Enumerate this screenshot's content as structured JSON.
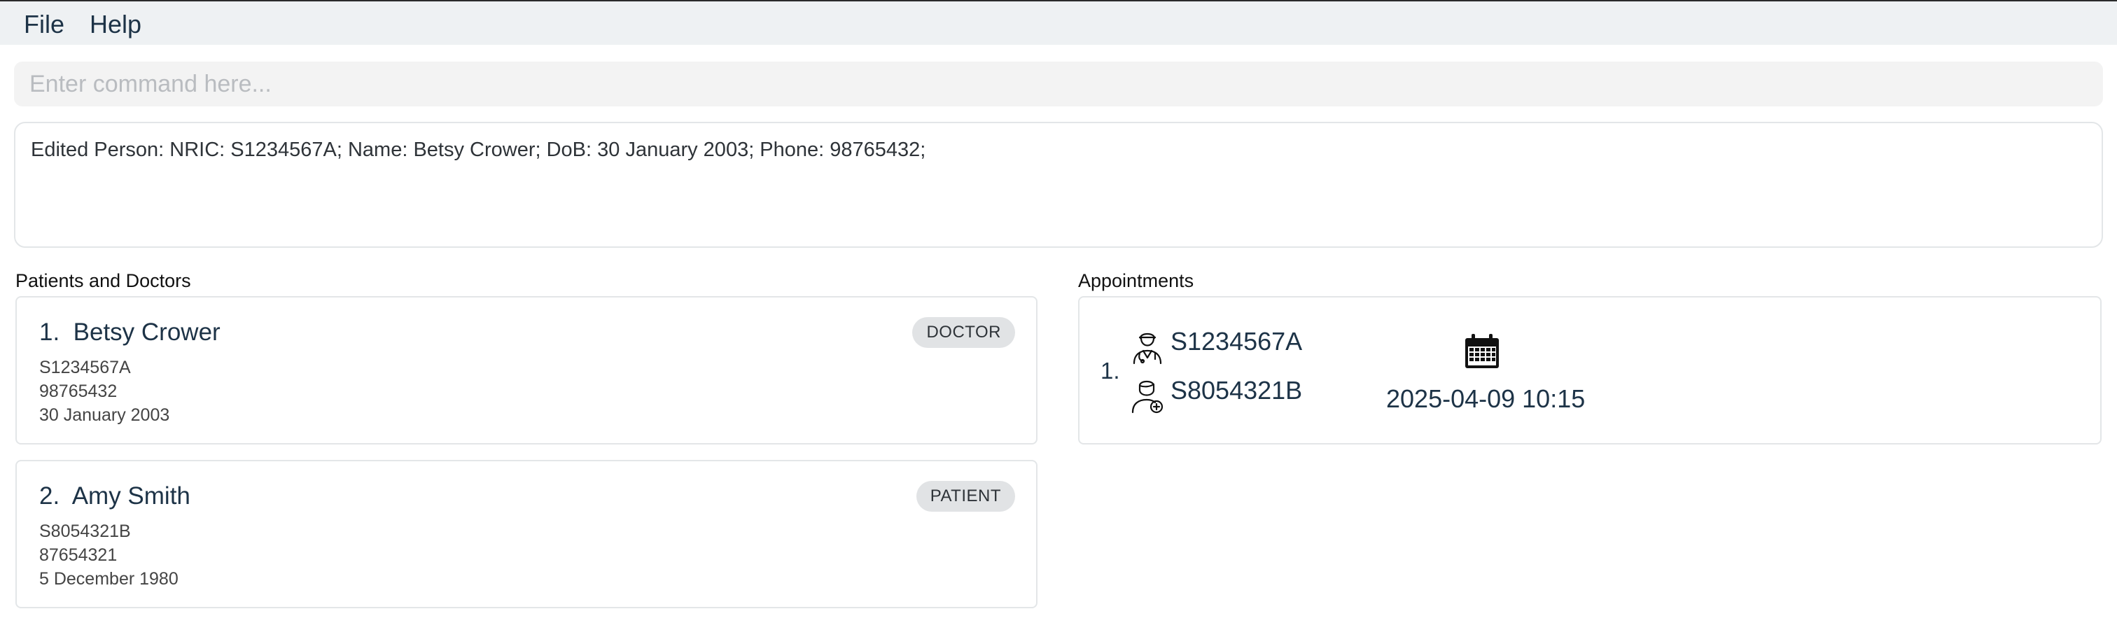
{
  "menu": {
    "file": "File",
    "help": "Help"
  },
  "command": {
    "placeholder": "Enter command here...",
    "value": ""
  },
  "result": {
    "message": "Edited Person: NRIC: S1234567A; Name: Betsy Crower; DoB: 30 January 2003; Phone: 98765432;"
  },
  "persons_panel": {
    "title": "Patients  and  Doctors",
    "persons": [
      {
        "label": "1.  Betsy Crower",
        "role": "DOCTOR",
        "nric": "S1234567A",
        "phone": "98765432",
        "dob": "30 January 2003"
      },
      {
        "label": "2.  Amy Smith",
        "role": "PATIENT",
        "nric": "S8054321B",
        "phone": "87654321",
        "dob": "5 December 1980"
      }
    ]
  },
  "appointments_panel": {
    "title": "Appointments",
    "appointments": [
      {
        "index": "1.",
        "doctor_nric": "S1234567A",
        "patient_nric": "S8054321B",
        "datetime": "2025-04-09 10:15",
        "doctor_icon": "doctor-icon",
        "patient_icon": "patient-icon",
        "date_icon": "calendar-icon"
      }
    ]
  }
}
